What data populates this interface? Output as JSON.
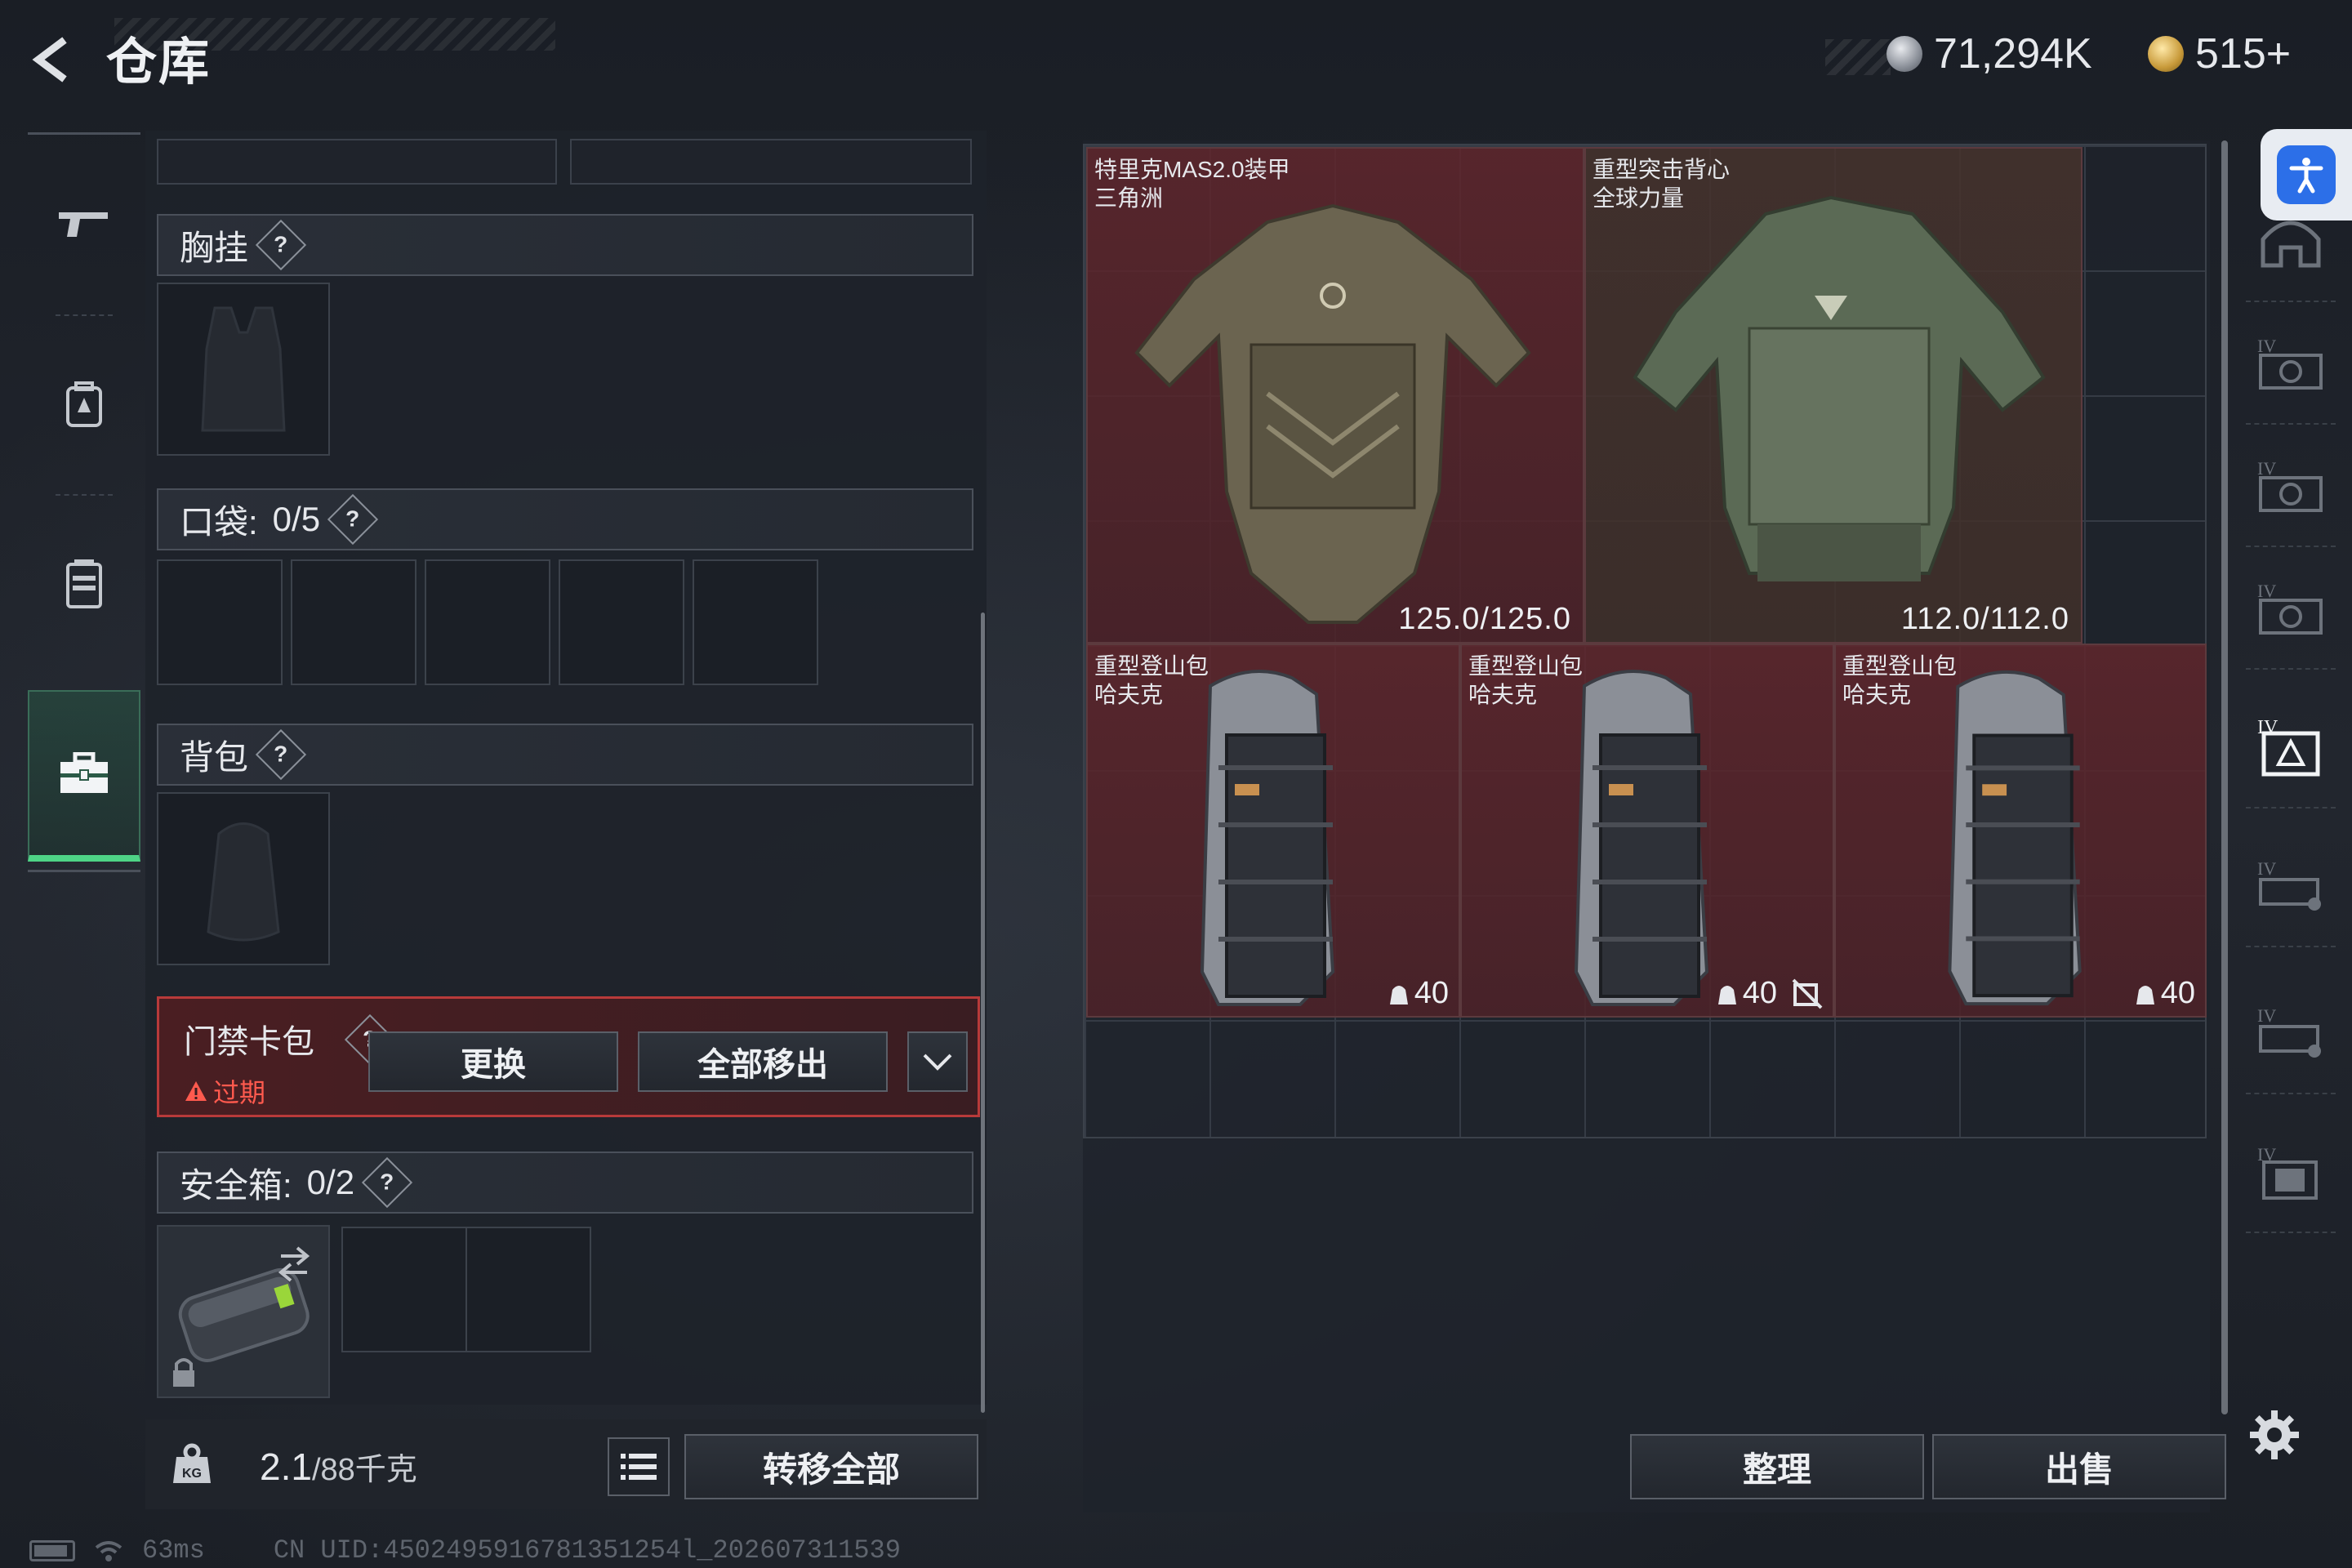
{
  "header": {
    "title": "仓库",
    "currencies": [
      {
        "icon": "silver-coin-icon",
        "value": "71,294K"
      },
      {
        "icon": "gold-coin-icon",
        "value": "515+"
      }
    ],
    "small_label": "???? ? ??"
  },
  "left_nav": [
    {
      "icon": "gun-icon",
      "active": false
    },
    {
      "icon": "backpack-icon",
      "active": false
    },
    {
      "icon": "armor-icon",
      "active": false
    },
    {
      "icon": "briefcase-icon",
      "active": true
    }
  ],
  "equipment": {
    "chest_rig_label": "胸挂",
    "pocket_label": "口袋:",
    "pocket_count": "0/5",
    "backpack_label": "背包",
    "keycard_label": "门禁卡包",
    "keycard_status": "过期",
    "swap_button": "更换",
    "move_all_button": "全部移出",
    "safe_box_label": "安全箱:",
    "safe_box_count": "0/2",
    "help_mark": "?"
  },
  "weight": {
    "current": "2.1",
    "capacity": "/88千克",
    "kg_icon_text": "KG",
    "transfer_all_button": "转移全部"
  },
  "status": {
    "ping": "63ms",
    "uid": "CN UID:4502495916781351254l_202607311539"
  },
  "storage": {
    "items": [
      {
        "name": "特里克MAS2.0装甲",
        "brand": "三角洲",
        "value": "125.0/125.0",
        "type": "armor"
      },
      {
        "name": "重型突击背心",
        "brand": "全球力量",
        "value": "112.0/112.0",
        "type": "vest"
      },
      {
        "name": "重型登山包",
        "brand": "哈夫克",
        "capacity": "40",
        "type": "backpack"
      },
      {
        "name": "重型登山包",
        "brand": "哈夫克",
        "capacity": "40",
        "type": "backpack",
        "no_insure": true
      },
      {
        "name": "重型登山包",
        "brand": "哈夫克",
        "capacity": "40",
        "type": "backpack"
      }
    ],
    "sort_button": "整理",
    "sell_button": "出售"
  },
  "right_categories": [
    {
      "icon": "helmet-category-icon",
      "tier": ""
    },
    {
      "icon": "armor-category-icon",
      "tier": "IV"
    },
    {
      "icon": "armor-category-icon",
      "tier": "IV"
    },
    {
      "icon": "armor-category-icon",
      "tier": "IV"
    },
    {
      "icon": "armor-category-icon",
      "tier": "IV"
    },
    {
      "icon": "bag-category-icon",
      "tier": "IV"
    },
    {
      "icon": "bag-category-icon",
      "tier": "IV"
    },
    {
      "icon": "case-category-icon",
      "tier": "IV"
    }
  ],
  "colors": {
    "accent_green": "#4ed486",
    "item_red": "#602a30",
    "warning_red": "#ff5a4e",
    "accessibility_blue": "#2c6fe8"
  }
}
